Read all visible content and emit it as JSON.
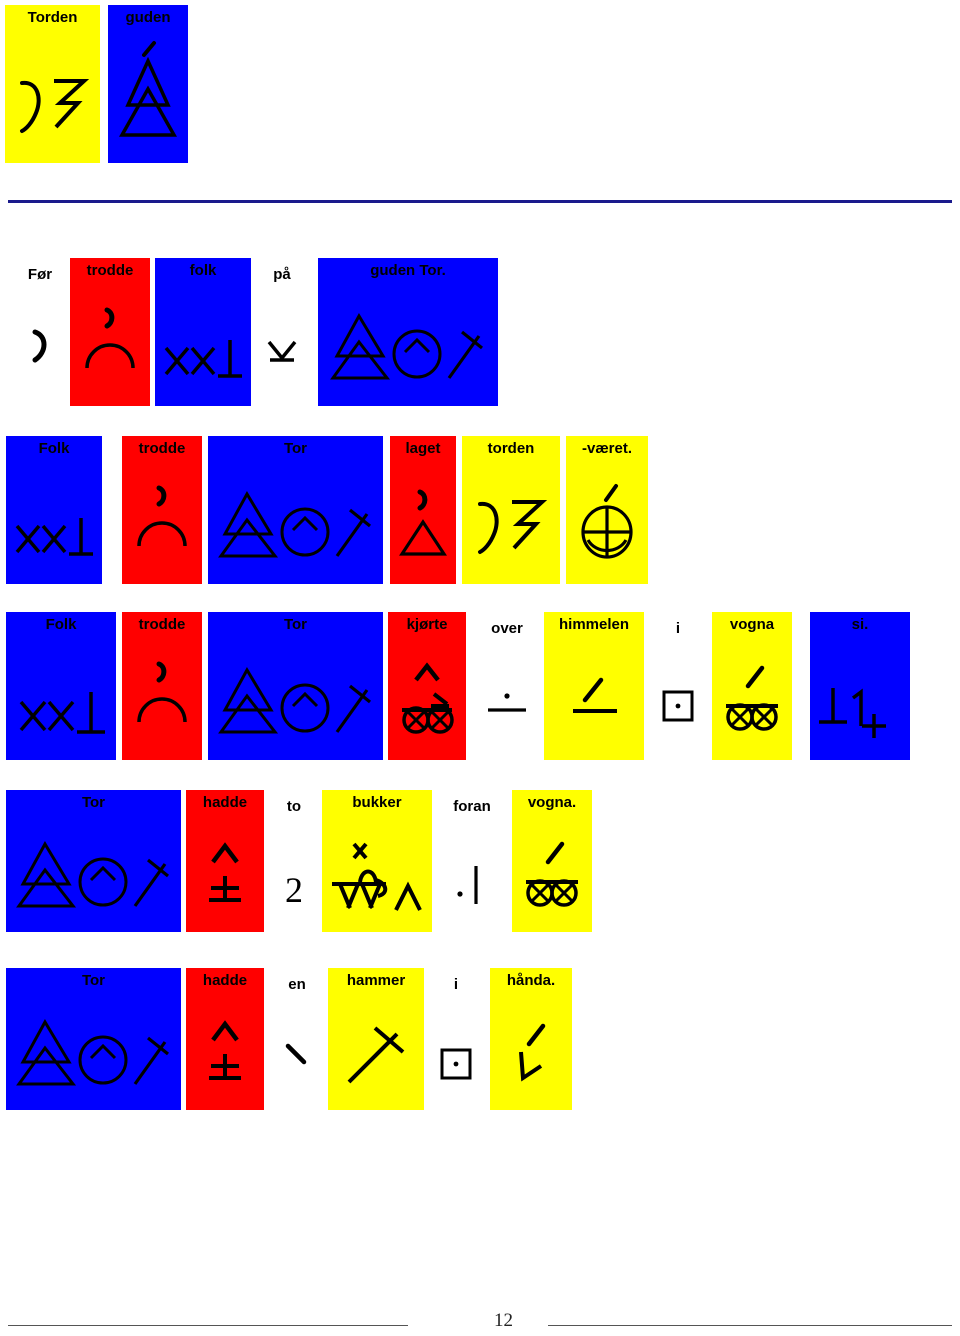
{
  "page": {
    "number": "12",
    "colors": {
      "yellow": "#FFFF00",
      "blue": "#0000FF",
      "red": "#FF0000",
      "rule": "#1a1a8c"
    }
  },
  "title_row": {
    "words": [
      {
        "text": "Torden",
        "color": "yellow",
        "symbol": "thunder"
      },
      {
        "text": "guden",
        "color": "blue",
        "symbol": "god-person"
      }
    ]
  },
  "rows": [
    {
      "id": "row-1",
      "sentence": "Før trodde folk på guden Tor.",
      "words": [
        {
          "text": "Før",
          "color": "white",
          "symbol": "before"
        },
        {
          "text": "trodde",
          "color": "red",
          "symbol": "believe"
        },
        {
          "text": "folk",
          "color": "blue",
          "symbol": "people"
        },
        {
          "text": "på",
          "color": "white",
          "symbol": "on"
        },
        {
          "text": "guden Tor.",
          "color": "blue",
          "symbol": "god-thor"
        }
      ]
    },
    {
      "id": "row-2",
      "sentence": "Folk trodde Tor laget torden-været.",
      "words": [
        {
          "text": "Folk",
          "color": "blue",
          "symbol": "people"
        },
        {
          "text": "trodde",
          "color": "red",
          "symbol": "believe"
        },
        {
          "text": "Tor",
          "color": "blue",
          "symbol": "god-thor"
        },
        {
          "text": "laget",
          "color": "red",
          "symbol": "make"
        },
        {
          "text": "torden",
          "color": "yellow",
          "symbol": "thunder"
        },
        {
          "text": "-været.",
          "color": "yellow",
          "symbol": "weather"
        }
      ]
    },
    {
      "id": "row-3",
      "sentence": "Folk trodde Tor kjørte over himmelen i vogna si.",
      "words": [
        {
          "text": "Folk",
          "color": "blue",
          "symbol": "people"
        },
        {
          "text": "trodde",
          "color": "red",
          "symbol": "believe"
        },
        {
          "text": "Tor",
          "color": "blue",
          "symbol": "god-thor"
        },
        {
          "text": "kjørte",
          "color": "red",
          "symbol": "drive"
        },
        {
          "text": "over",
          "color": "white",
          "symbol": "over"
        },
        {
          "text": "himmelen",
          "color": "yellow",
          "symbol": "sky"
        },
        {
          "text": "i",
          "color": "white",
          "symbol": "in"
        },
        {
          "text": "vogna",
          "color": "yellow",
          "symbol": "wagon"
        },
        {
          "text": "si.",
          "color": "blue",
          "symbol": "his-own"
        }
      ]
    },
    {
      "id": "row-4",
      "sentence": "Tor hadde to bukker foran vogna.",
      "words": [
        {
          "text": "Tor",
          "color": "blue",
          "symbol": "god-thor"
        },
        {
          "text": "hadde",
          "color": "red",
          "symbol": "have"
        },
        {
          "text": "to",
          "color": "white",
          "symbol": "two"
        },
        {
          "text": "bukker",
          "color": "yellow",
          "symbol": "goats"
        },
        {
          "text": "foran",
          "color": "white",
          "symbol": "in-front-of"
        },
        {
          "text": "vogna.",
          "color": "yellow",
          "symbol": "wagon"
        }
      ]
    },
    {
      "id": "row-5",
      "sentence": "Tor hadde en hammer i hånda.",
      "words": [
        {
          "text": "Tor",
          "color": "blue",
          "symbol": "god-thor"
        },
        {
          "text": "hadde",
          "color": "red",
          "symbol": "have"
        },
        {
          "text": "en",
          "color": "white",
          "symbol": "a-indefinite"
        },
        {
          "text": "hammer",
          "color": "yellow",
          "symbol": "hammer"
        },
        {
          "text": "i",
          "color": "white",
          "symbol": "in"
        },
        {
          "text": "hånda.",
          "color": "yellow",
          "symbol": "hand"
        }
      ]
    }
  ]
}
